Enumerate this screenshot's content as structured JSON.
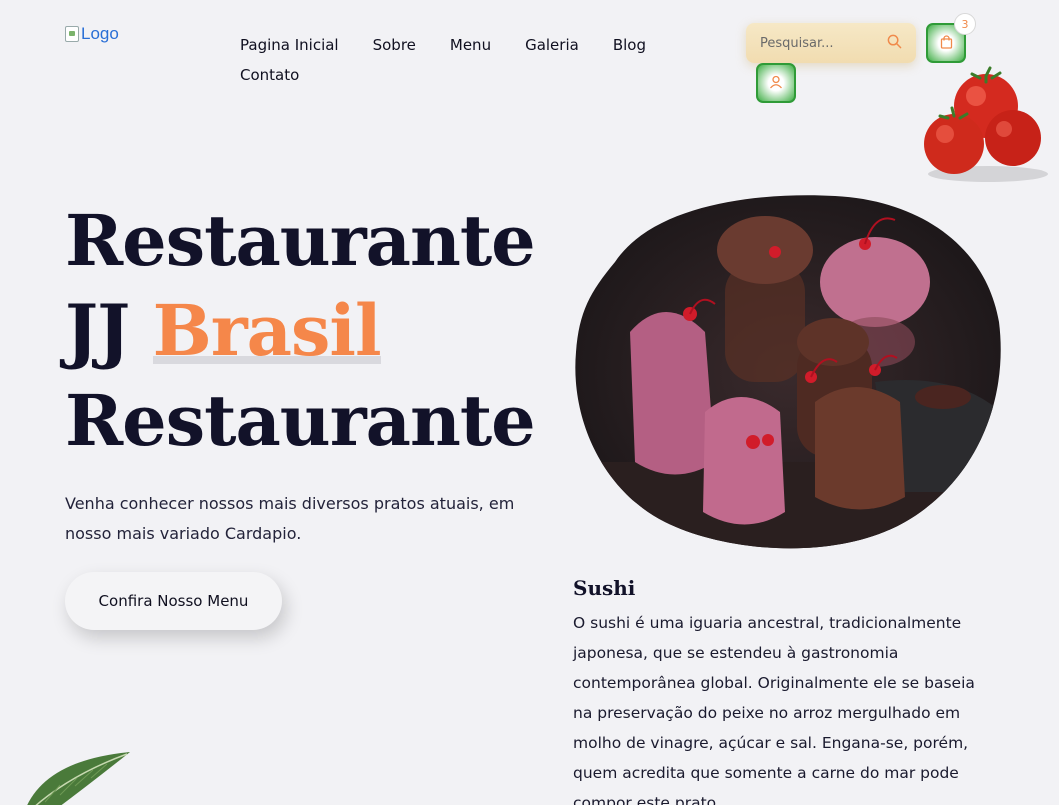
{
  "header": {
    "logo_alt": "Logo",
    "nav": [
      {
        "label": "Pagina Inicial"
      },
      {
        "label": "Sobre"
      },
      {
        "label": "Menu"
      },
      {
        "label": "Galeria"
      },
      {
        "label": "Blog"
      },
      {
        "label": "Contato"
      }
    ],
    "search": {
      "placeholder": "Pesquisar...",
      "icon": "search-icon"
    },
    "cart": {
      "count": "3",
      "icon": "shopping-bag-icon"
    },
    "user": {
      "icon": "user-icon"
    }
  },
  "hero": {
    "title_line1": "Restaurante",
    "title_line2_plain": "JJ ",
    "title_line2_accent": "Brasil",
    "title_line3": "Restaurante",
    "description": "Venha conhecer nossos mais diversos pratos atuais, em nosso mais variado Cardapio.",
    "cta_label": "Confira Nosso Menu"
  },
  "featured": {
    "title": "Sushi",
    "description": "O sushi é uma iguaria ancestral, tradicionalmente japonesa, que se estendeu à gastronomia contemporânea global. Originalmente ele se baseia na preservação do peixe no arroz mergulhado em molho de vinagre, açúcar e sal. Engana-se, porém, quem acredita que somente a carne do mar pode compor este prato."
  },
  "colors": {
    "accent": "#f5874a",
    "dark": "#121229",
    "green": "#3fae45",
    "background": "#f2f2f5"
  }
}
